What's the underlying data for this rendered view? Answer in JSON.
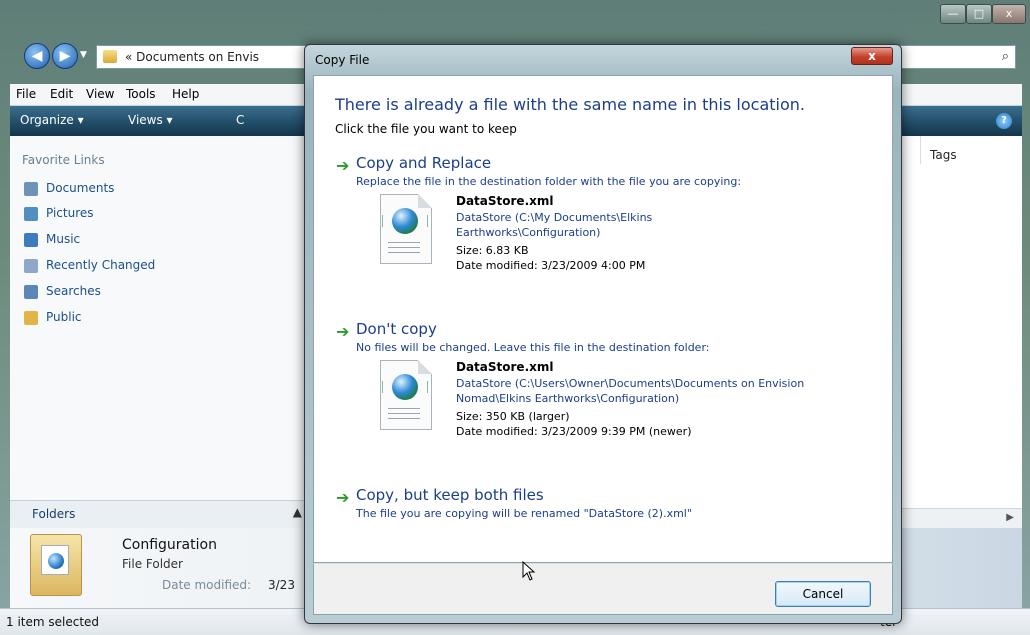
{
  "explorer": {
    "address": "« Documents on Envis",
    "caption_buttons": {
      "minimize": "—",
      "maximize": "□",
      "close": "x"
    },
    "menu": [
      "File",
      "Edit",
      "View",
      "Tools",
      "Help"
    ],
    "toolbar": {
      "organize": "Organize ▾",
      "views": "Views ▾",
      "partial": "C"
    },
    "favorite_links_header": "Favorite Links",
    "favorite_links": [
      {
        "label": "Documents",
        "icon": "documents-icon",
        "color": "#6f93b8"
      },
      {
        "label": "Pictures",
        "icon": "pictures-icon",
        "color": "#4f8fc1"
      },
      {
        "label": "Music",
        "icon": "music-icon",
        "color": "#3f79c0"
      },
      {
        "label": "Recently Changed",
        "icon": "recently-changed-icon",
        "color": "#8ea9c7"
      },
      {
        "label": "Searches",
        "icon": "searches-icon",
        "color": "#5b87b8"
      },
      {
        "label": "Public",
        "icon": "public-folder-icon",
        "color": "#e2b646"
      }
    ],
    "folders_label": "Folders",
    "column_header": "Tags",
    "details": {
      "name": "Configuration",
      "type": "File Folder",
      "modified_label": "Date modified:",
      "modified_value": "3/23"
    },
    "status": "1 item selected",
    "status_right": "ter"
  },
  "dialog": {
    "title": "Copy File",
    "close_label": "x",
    "heading": "There is already a file with the same name in this location.",
    "subheading": "Click the file you want to keep",
    "options": [
      {
        "title": "Copy and Replace",
        "description": "Replace the file in the destination folder with the file you are copying:",
        "file": {
          "name": "DataStore.xml",
          "path": "DataStore (C:\\My Documents\\Elkins Earthworks\\Configuration)",
          "size": "Size: 6.83 KB",
          "date": "Date modified: 3/23/2009 4:00 PM"
        }
      },
      {
        "title": "Don't copy",
        "description": "No files will be changed. Leave this file in the destination folder:",
        "file": {
          "name": "DataStore.xml",
          "path": "DataStore (C:\\Users\\Owner\\Documents\\Documents on Envision Nomad\\Elkins Earthworks\\Configuration)",
          "size": "Size: 350 KB (larger)",
          "date": "Date modified: 3/23/2009 9:39 PM (newer)"
        }
      },
      {
        "title": "Copy, but keep both files",
        "description": "The file you are copying will be renamed \"DataStore (2).xml\""
      }
    ],
    "cancel_label": "Cancel"
  },
  "colors": {
    "link_blue": "#1b3e8c",
    "arrow_green": "#2a9a2a",
    "toolbar_dark": "#1f4b66"
  }
}
